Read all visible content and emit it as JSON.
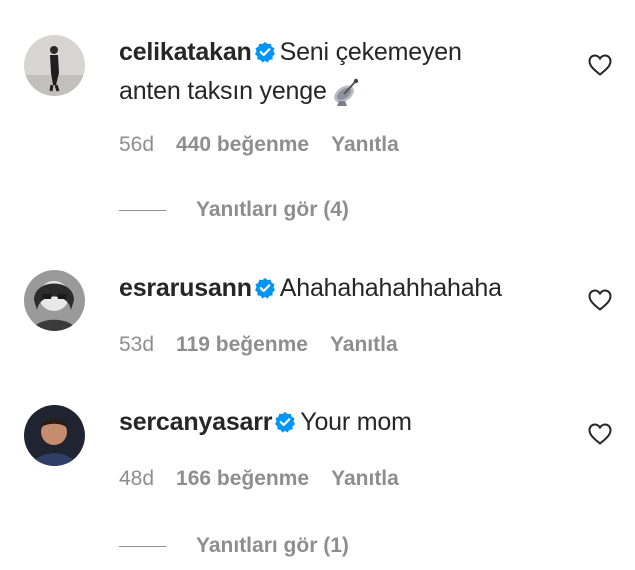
{
  "comments": [
    {
      "username": "celikatakan",
      "text_line1": "Seni çekemeyen",
      "text_line2": "anten taksın yenge",
      "emoji": "satellite-antenna",
      "time": "56d",
      "likes": "440 beğenme",
      "reply": "Yanıtla",
      "view_replies": "Yanıtları gör (4)"
    },
    {
      "username": "esrarusann",
      "text": "Ahahahahahhahaha",
      "time": "53d",
      "likes": "119 beğenme",
      "reply": "Yanıtla"
    },
    {
      "username": "sercanyasarr",
      "text": "Your mom",
      "time": "48d",
      "likes": "166 beğenme",
      "reply": "Yanıtla",
      "view_replies": "Yanıtları gör (1)"
    }
  ],
  "colors": {
    "text": "#262626",
    "muted": "#8e8e8e",
    "verified": "#0095f6"
  },
  "icons": [
    "verified-badge-icon",
    "heart-outline-icon",
    "satellite-antenna-icon"
  ]
}
